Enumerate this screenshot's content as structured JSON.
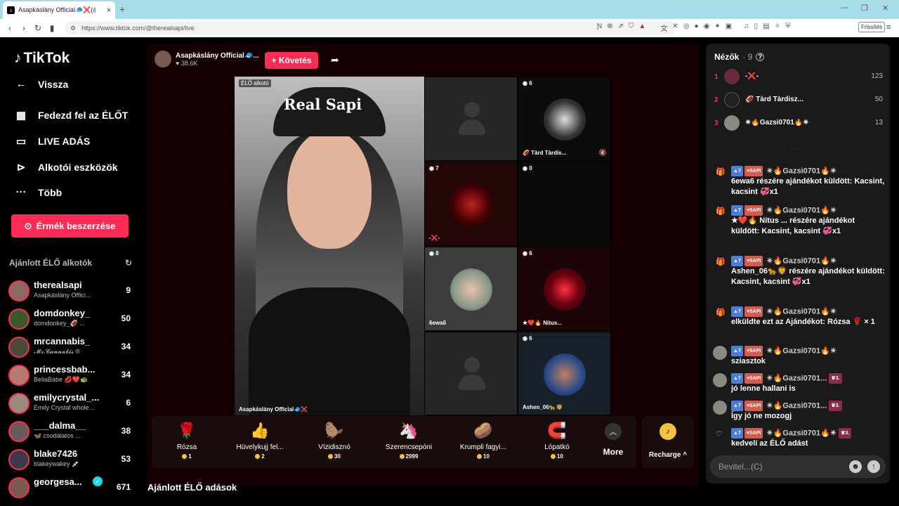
{
  "browser": {
    "tab_title": "Asapkáslány Official🧢❌(@",
    "url": "https://www.tiktok.com/@therealsapi/live",
    "refresh_label": "Frissítés"
  },
  "sidebar": {
    "brand": "TikTok",
    "nav": [
      {
        "label": "Vissza",
        "icon": "←"
      },
      {
        "label": "Fedezd fel az ÉLŐT",
        "icon": "▦"
      },
      {
        "label": "LIVE ADÁS",
        "icon": "▭"
      },
      {
        "label": "Alkotói eszközök",
        "icon": "⊳"
      },
      {
        "label": "Több",
        "icon": "···"
      }
    ],
    "coins_button": "Érmék beszerzése",
    "suggested_title": "Ajánlott ÉLŐ alkotók",
    "creators": [
      {
        "name": "therealsapi",
        "sub": "Asapkáslány Offici...",
        "count": "9"
      },
      {
        "name": "domdonkey_",
        "sub": "domdonkey_🏈 ...",
        "count": "50"
      },
      {
        "name": "mrcannabis_",
        "sub": "𝓜𝓻.𝓒𝓪𝓷𝓷𝓪𝓫𝓲𝓼 ®",
        "count": "34"
      },
      {
        "name": "princessbab...",
        "sub": "BellaBabe 💋❤️🐢",
        "count": "34"
      },
      {
        "name": "emilycrystal_...",
        "sub": "Emily Crystal whole...",
        "count": "6"
      },
      {
        "name": "___dalma__",
        "sub": "🦋 csodálatos ...",
        "count": "38"
      },
      {
        "name": "blake7426",
        "sub": "blakeywakey 💉",
        "count": "53"
      },
      {
        "name": "georgesa...",
        "sub": "",
        "count": "671"
      }
    ]
  },
  "stream": {
    "streamer_name": "Asapkáslány Official🧢...",
    "likes": "38.6K",
    "follow_label": "+ Követés",
    "live_badge": "ÉLŐ alkotó",
    "cap_text": "Real Sapi",
    "host_label": "Asapkáslány Official🧢❌",
    "tiles": [
      {
        "count": "",
        "label": ""
      },
      {
        "count": "6",
        "label": "🏈 Tàrd Tàrdis..."
      },
      {
        "count": "7",
        "label": "-❌-"
      },
      {
        "count": "0",
        "label": ""
      },
      {
        "count": "8",
        "label": "6ewa6"
      },
      {
        "count": "6",
        "label": "★❤️🔥 Nitus..."
      },
      {
        "count": "",
        "label": ""
      },
      {
        "count": "6",
        "label": "Ashen_06🐆🦁"
      }
    ]
  },
  "gifts": [
    {
      "name": "Rózsa",
      "price": "1",
      "icon": "🌹"
    },
    {
      "name": "Hüvelykujj fel...",
      "price": "2",
      "icon": "👍"
    },
    {
      "name": "Vízidisznó",
      "price": "30",
      "icon": "🦫"
    },
    {
      "name": "Szerencsepóni",
      "price": "2999",
      "icon": "🦄"
    },
    {
      "name": "Krumpli fagyi...",
      "price": "10",
      "icon": "🥔"
    },
    {
      "name": "Lópatkó",
      "price": "10",
      "icon": "🧲"
    }
  ],
  "gift_more": "More",
  "recharge": "Recharge ^",
  "recommended_live": "Ajánlott ÉLŐ adások",
  "chat": {
    "viewers_label": "Nézők",
    "viewers_count": "· 9",
    "ranking": [
      {
        "rank": "1",
        "name": "-❌-",
        "score": "123"
      },
      {
        "rank": "2",
        "name": "🏈 Tàrd Tàrdisz...",
        "score": "50"
      },
      {
        "rank": "3",
        "name": "✴🔥Gazsi0701🔥✴",
        "score": "13"
      }
    ],
    "faded_line": "··· ···",
    "messages": [
      {
        "lvl": "7",
        "fan": "SAPI",
        "user": "✴🔥Gazsi0701🔥✴",
        "text": "6ewa6 részére ajándékot küldött: Kacsint, kacsint 💞x1"
      },
      {
        "lvl": "7",
        "fan": "SAPI",
        "user": "✴🔥Gazsi0701🔥✴",
        "text": "★❤️🔥 Nitus ... részére ajándékot küldött: Kacsint, kacsint 💞x1"
      },
      {
        "lvl": "7",
        "fan": "SAPI",
        "user": "✴🔥Gazsi0701🔥✴",
        "text": "Ashen_06🐆🦁 részére ajándékot küldött: Kacsint, kacsint 💞x1"
      },
      {
        "lvl": "7",
        "fan": "SAPI",
        "user": "✴🔥Gazsi0701🔥✴",
        "text": "elküldte ezt az Ajándékot: Rózsa 🌹 × 1"
      },
      {
        "lvl": "7",
        "fan": "SAPI",
        "user": "✴🔥Gazsi0701🔥✴",
        "text": "sziasztok"
      },
      {
        "lvl": "7",
        "fan": "SAPI",
        "user": "✴🔥Gazsi0701...",
        "rank": "3.",
        "text": "jó lenne hallani is"
      },
      {
        "lvl": "7",
        "fan": "SAPI",
        "user": "✴🔥Gazsi0701...",
        "rank": "3.",
        "text": "Így jó ne mozogj"
      },
      {
        "lvl": "7",
        "fan": "SAPI",
        "user": "✴🔥Gazsi0701🔥✴",
        "rank": "3.",
        "text": "kedvelí az ÉLŐ adást"
      }
    ],
    "input_placeholder": "Bevitel...(C)"
  }
}
